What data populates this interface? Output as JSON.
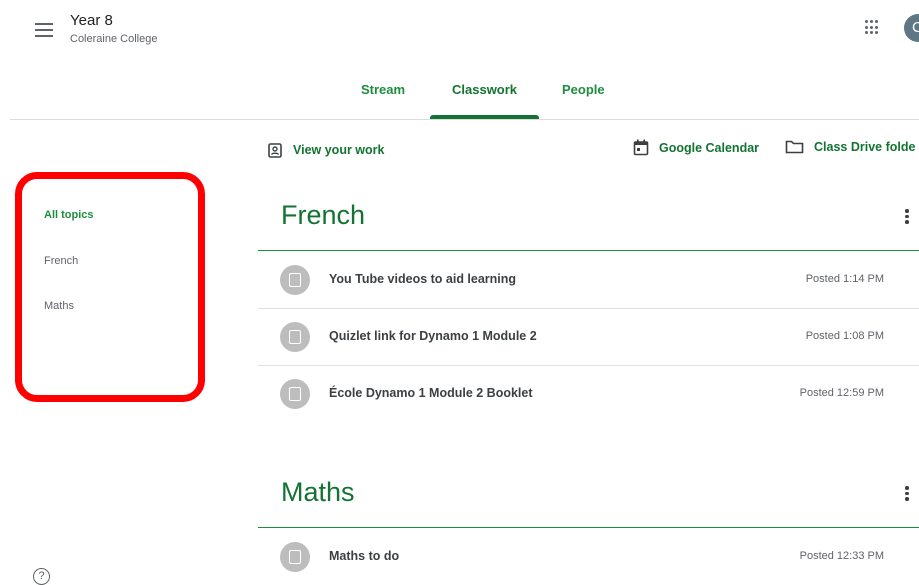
{
  "header": {
    "title": "Year 8",
    "subtitle": "Coleraine College",
    "avatar_letter": "C",
    "icons": [
      "menu-icon",
      "apps-grid-icon"
    ]
  },
  "tabs": [
    {
      "label": "Stream",
      "active": false
    },
    {
      "label": "Classwork",
      "active": true
    },
    {
      "label": "People",
      "active": false
    }
  ],
  "sidebar": {
    "topics": [
      {
        "label": "All topics",
        "active": true
      },
      {
        "label": "French",
        "active": false
      },
      {
        "label": "Maths",
        "active": false
      }
    ],
    "highlight_color": "#ff0000"
  },
  "toolbar": {
    "view_work": "View your work",
    "google_calendar": "Google Calendar",
    "class_drive": "Class Drive folde"
  },
  "sections": [
    {
      "title": "French",
      "items": [
        {
          "title": "You Tube videos to aid learning",
          "posted": "Posted 1:14 PM"
        },
        {
          "title": "Quizlet link for Dynamo 1 Module 2",
          "posted": "Posted 1:08 PM"
        },
        {
          "title": "École Dynamo 1 Module 2 Booklet",
          "posted": "Posted 12:59 PM"
        }
      ]
    },
    {
      "title": "Maths",
      "items": [
        {
          "title": "Maths to do",
          "posted": "Posted 12:33 PM"
        }
      ]
    }
  ],
  "colors": {
    "accent": "#137333",
    "highlight": "#ff0000"
  }
}
